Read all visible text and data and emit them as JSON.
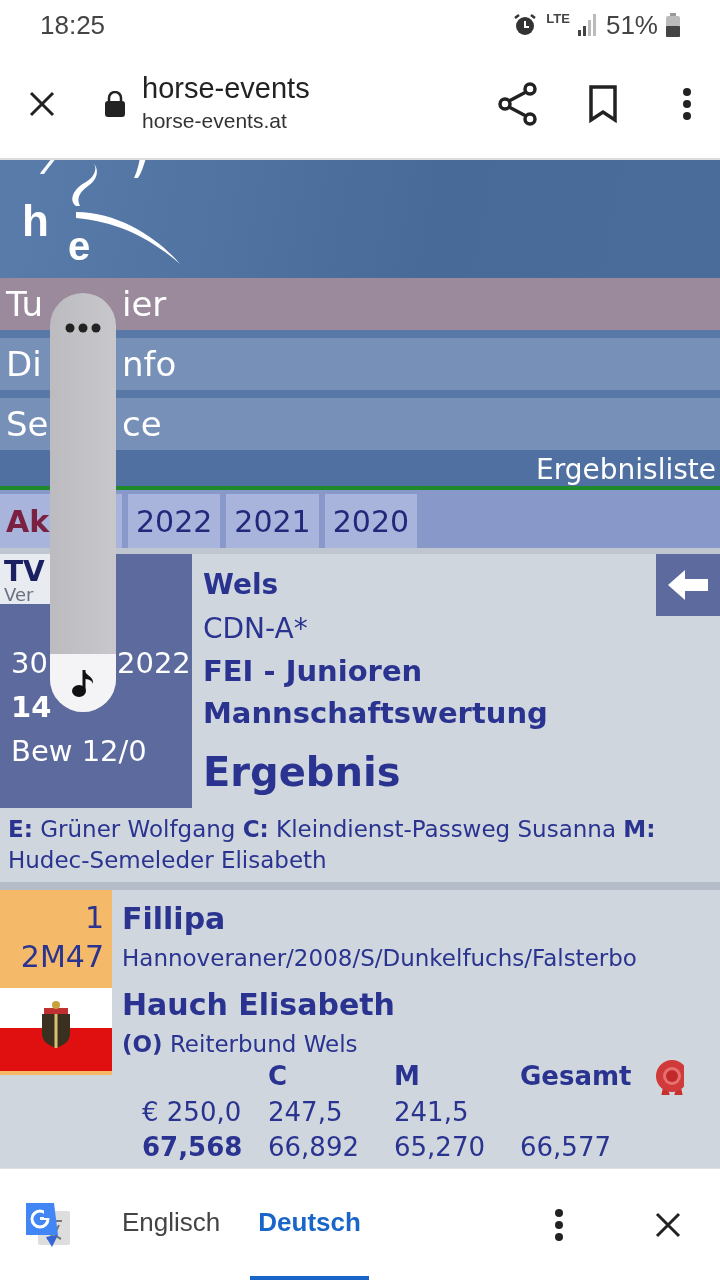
{
  "status_bar": {
    "time": "18:25",
    "network": "LTE",
    "battery": "51%"
  },
  "browser": {
    "title": "horse-events",
    "url": "horse-events.at"
  },
  "site": {
    "logo": [
      "h",
      "e"
    ],
    "menu": [
      {
        "start": "Tu",
        "end": "ier",
        "selected": true
      },
      {
        "start": "Di",
        "end": "nfo",
        "selected": false
      },
      {
        "start": "Se",
        "end": "ce",
        "selected": false
      }
    ],
    "breadcrumb": "Ergebnisliste",
    "year_tabs": [
      {
        "label": "Ak",
        "selected": true
      },
      {
        "label": "2022",
        "selected": false
      },
      {
        "label": "2021",
        "selected": false
      },
      {
        "label": "2020",
        "selected": false
      }
    ]
  },
  "event": {
    "logo_text": "TV",
    "logo_sub": "Ver",
    "date_start": "30",
    "date_end": "2022",
    "time": "14",
    "ratings": "Bew 12/0",
    "place": "Wels",
    "category": "CDN-A*",
    "title_lines": [
      "FEI - Junioren",
      "Mannschaftswertung"
    ],
    "heading": "Ergebnis",
    "judges": "**E:** Grüner Wolfgang **C:** Kleindienst-Passweg Susanna **M:** Hudec-Semeleder Elisabeth"
  },
  "result": {
    "rank": "1",
    "number": "2M47",
    "horse": "Fillipa",
    "horse_details": "Hannoveraner/2008/S/Dunkelfuchs/Falsterbo",
    "rider": "Hauch Elisabeth",
    "club": "**(O)** Reiterbund Wels",
    "columns": [
      "",
      "C",
      "M",
      "Gesamt"
    ],
    "rows": [
      [
        {
          "text": "€ 250,0",
          "bold": false
        },
        {
          "text": "247,5",
          "bold": false
        },
        {
          "text": "241,5",
          "bold": false
        }
      ],
      [
        {
          "text": "67,568",
          "bold": true
        },
        {
          "text": "66,892",
          "bold": false
        },
        {
          "text": "65,270",
          "bold": false
        },
        {
          "text": "66,577",
          "bold": false
        }
      ]
    ]
  },
  "translate_bar": {
    "languages": [
      {
        "label": "Englisch",
        "selected": false
      },
      {
        "label": "Deutsch",
        "selected": true
      }
    ]
  }
}
